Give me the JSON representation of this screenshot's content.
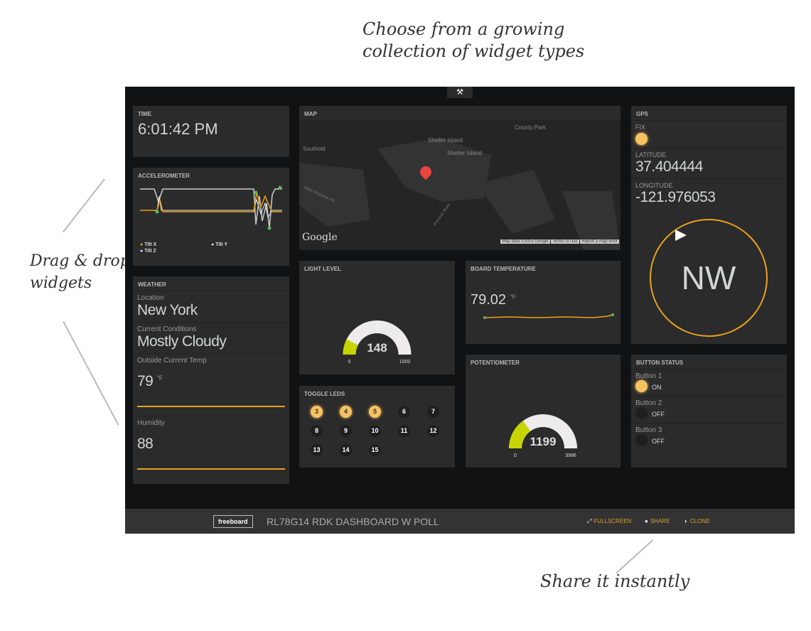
{
  "annotations": {
    "top_line1": "Choose from a growing",
    "top_line2": "collection of widget types",
    "left_line1": "Drag & drop",
    "left_line2": "widgets",
    "bottom": "Share it instantly"
  },
  "colors": {
    "accent": "#f8c261",
    "orange": "#e8a21e",
    "panel": "#2b2b2b",
    "background": "#101214",
    "green": "#5cb85c"
  },
  "toolbar": {
    "icon": "wrench-icon"
  },
  "time": {
    "title": "TIME",
    "value": "6:01:42 PM"
  },
  "accelerometer": {
    "title": "ACCELEROMETER",
    "legend": [
      "Tilt X",
      "Tilt Y",
      "Tilt Z"
    ]
  },
  "weather": {
    "title": "WEATHER",
    "location_label": "Location",
    "location": "New York",
    "conditions_label": "Current Conditions",
    "conditions": "Mostly Cloudy",
    "temp_label": "Outside Current Temp",
    "temp": "79",
    "temp_unit": "°F",
    "humidity_label": "Humidity",
    "humidity": "88"
  },
  "map": {
    "title": "MAP",
    "labels": [
      "County Park",
      "Southold",
      "Shelter Island",
      "Shelter Island",
      "Main Bayview Rd",
      "Peconic River"
    ],
    "google": "Google",
    "attrib": [
      "Map data ©2015 Google",
      "Terms of Use",
      "Report a map error"
    ]
  },
  "light": {
    "title": "LIGHT LEVEL",
    "value": "148",
    "min": "0",
    "max": "1000",
    "fraction": 0.148
  },
  "leds": {
    "title": "TOGGLE LEDS",
    "items": [
      {
        "n": "3",
        "on": true
      },
      {
        "n": "4",
        "on": true
      },
      {
        "n": "5",
        "on": true
      },
      {
        "n": "6",
        "on": false
      },
      {
        "n": "7",
        "on": false
      },
      {
        "n": "8",
        "on": false
      },
      {
        "n": "9",
        "on": false
      },
      {
        "n": "10",
        "on": false
      },
      {
        "n": "11",
        "on": false
      },
      {
        "n": "12",
        "on": false
      },
      {
        "n": "13",
        "on": false
      },
      {
        "n": "14",
        "on": false
      },
      {
        "n": "15",
        "on": false
      }
    ]
  },
  "board_temp": {
    "title": "BOARD TEMPERATURE",
    "value": "79.02",
    "unit": "°F"
  },
  "pot": {
    "title": "POTENTIOMETER",
    "value": "1199",
    "min": "0",
    "max": "3996",
    "fraction": 0.3
  },
  "gps": {
    "title": "GPS",
    "fix_label": "FIX",
    "lat_label": "LATITUDE",
    "lat": "37.404444",
    "lon_label": "LONGITUDE",
    "lon": "-121.976053",
    "heading": "NW"
  },
  "buttons": {
    "title": "BUTTON STATUS",
    "items": [
      {
        "label": "Button 1",
        "state": "ON"
      },
      {
        "label": "Button 2",
        "state": "OFF"
      },
      {
        "label": "Button 3",
        "state": "OFF"
      }
    ]
  },
  "footer": {
    "logo": "freeboard",
    "title": "RL78G14 RDK DASHBOARD W POLL",
    "fullscreen": "FULLSCREEN",
    "share": "SHARE",
    "clone": "CLONE"
  }
}
